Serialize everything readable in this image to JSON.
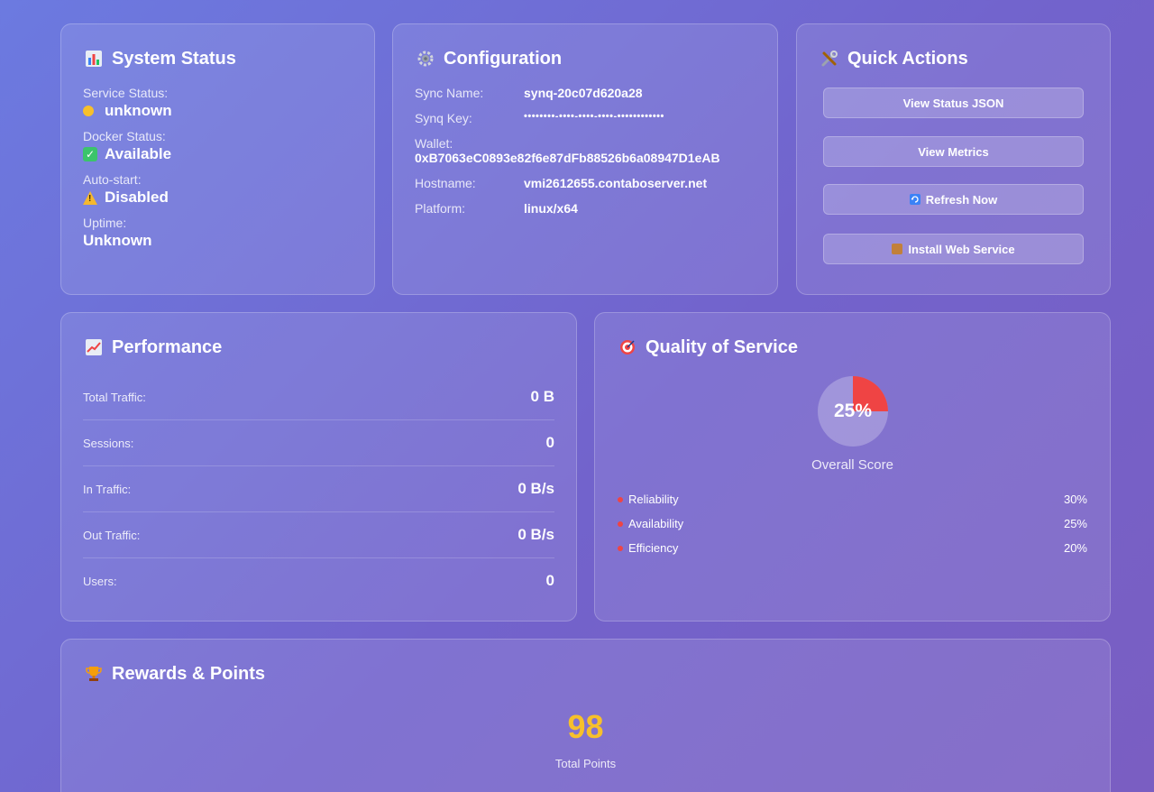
{
  "system_status": {
    "title": "System Status",
    "title_icon": "bar-chart-icon",
    "service_status_label": "Service Status:",
    "service_status_value": "unknown",
    "docker_status_label": "Docker Status:",
    "docker_status_value": "Available",
    "autostart_label": "Auto-start:",
    "autostart_value": "Disabled",
    "uptime_label": "Uptime:",
    "uptime_value": "Unknown"
  },
  "configuration": {
    "title": "Configuration",
    "title_icon": "gear-icon",
    "sync_name_label": "Sync Name:",
    "sync_name_value": "synq-20c07d620a28",
    "synq_key_label": "Synq Key:",
    "synq_key_value": "••••••••-••••-••••-••••-••••••••••••",
    "wallet_label": "Wallet:",
    "wallet_value": "0xB7063eC0893e82f6e87dFb88526b6a08947D1eAB",
    "hostname_label": "Hostname:",
    "hostname_value": "vmi2612655.contaboserver.net",
    "platform_label": "Platform:",
    "platform_value": "linux/x64"
  },
  "quick_actions": {
    "title": "Quick Actions",
    "title_icon": "tools-icon",
    "buttons": [
      {
        "label": "View Status JSON",
        "icon": ""
      },
      {
        "label": "View Metrics",
        "icon": ""
      },
      {
        "label": "Refresh Now",
        "icon": "refresh-icon"
      },
      {
        "label": "Install Web Service",
        "icon": "package-icon"
      }
    ]
  },
  "performance": {
    "title": "Performance",
    "title_icon": "chart-increasing-icon",
    "rows": [
      {
        "label": "Total Traffic:",
        "value": "0 B"
      },
      {
        "label": "Sessions:",
        "value": "0"
      },
      {
        "label": "In Traffic:",
        "value": "0 B/s"
      },
      {
        "label": "Out Traffic:",
        "value": "0 B/s"
      },
      {
        "label": "Users:",
        "value": "0"
      }
    ]
  },
  "quality_of_service": {
    "title": "Quality of Service",
    "title_icon": "target-icon",
    "score_text": "25%",
    "score_fraction": 0.25,
    "score_label": "Overall Score",
    "metrics": [
      {
        "name": "Reliability",
        "value": "30%"
      },
      {
        "name": "Availability",
        "value": "25%"
      },
      {
        "name": "Efficiency",
        "value": "20%"
      }
    ],
    "colors": {
      "score": "#ef4444",
      "track": "rgba(255,255,255,0.25)"
    }
  },
  "rewards": {
    "title": "Rewards & Points",
    "title_icon": "trophy-icon",
    "points_value": "98",
    "points_label": "Total Points"
  },
  "colors": {
    "accent_yellow": "#f7c02b",
    "status_green": "#3bc46b",
    "status_red": "#ef4444"
  }
}
